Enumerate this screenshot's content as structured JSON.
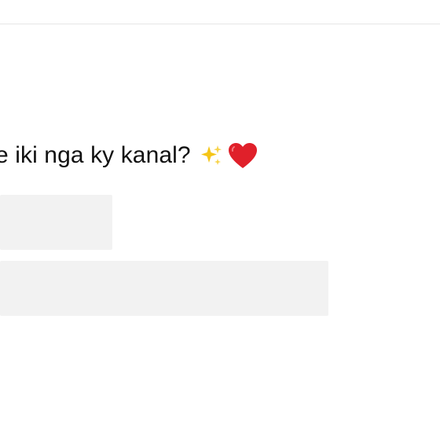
{
  "post": {
    "caption": "e iki nga ky kanal?",
    "emojis": [
      "sparkles-icon",
      "red-heart-icon"
    ]
  },
  "colors": {
    "background": "#ffffff",
    "text": "#111111",
    "skeleton": "#f2f2f2",
    "sparkle": "#f5c518",
    "heart": "#e0202a"
  }
}
